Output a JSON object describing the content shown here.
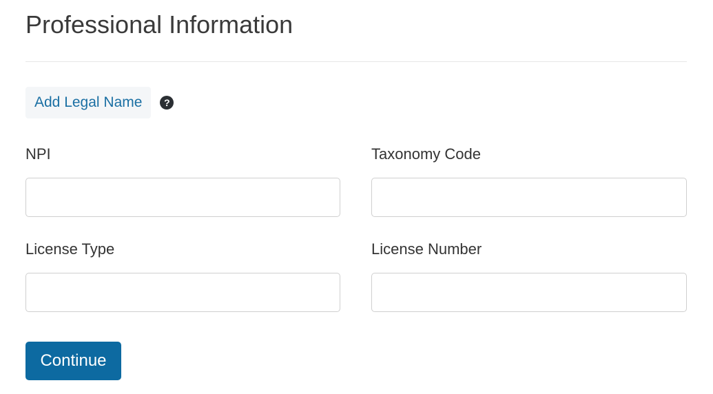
{
  "page": {
    "title": "Professional Information"
  },
  "legal_name": {
    "button_label": "Add Legal Name",
    "help_icon": "question-circle-icon",
    "help_glyph": "?"
  },
  "fields": {
    "npi": {
      "label": "NPI",
      "value": "",
      "placeholder": ""
    },
    "taxonomy_code": {
      "label": "Taxonomy Code",
      "value": "",
      "placeholder": ""
    },
    "license_type": {
      "label": "License Type",
      "value": "",
      "placeholder": ""
    },
    "license_number": {
      "label": "License Number",
      "value": "",
      "placeholder": ""
    }
  },
  "actions": {
    "continue_label": "Continue"
  },
  "colors": {
    "link": "#1a6fa3",
    "primary_button": "#0d6aa1",
    "help_icon_bg": "#2b2f33"
  }
}
